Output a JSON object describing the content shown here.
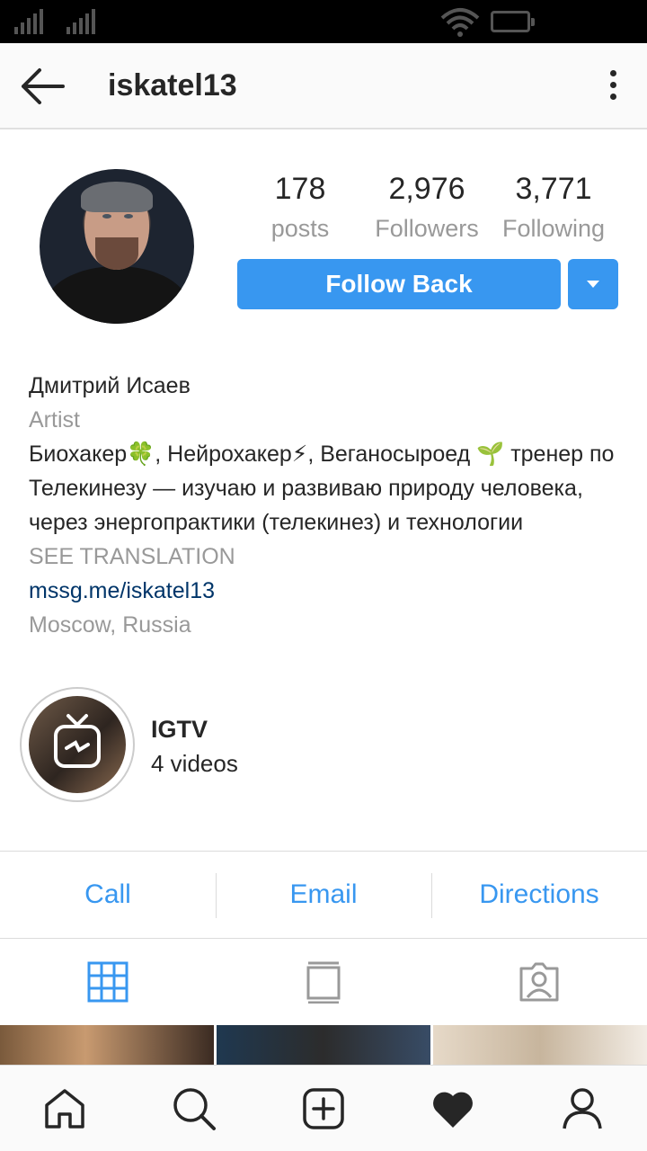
{
  "header": {
    "username": "iskatel13",
    "back_icon": "arrow-left-icon",
    "more_icon": "more-vertical-icon"
  },
  "stats": {
    "posts": {
      "value": "178",
      "label": "posts"
    },
    "followers": {
      "value": "2,976",
      "label": "Followers"
    },
    "following": {
      "value": "3,771",
      "label": "Following"
    }
  },
  "actions": {
    "follow_label": "Follow Back",
    "dropdown_icon": "caret-down-icon"
  },
  "bio": {
    "name": "Дмитрий Исаев",
    "category": "Artist",
    "text": "Биохакер🍀, Нейрохакер⚡, Веганосыроед 🌱 тренер по Телекинезу — изучаю и развиваю природу человека, через энергопрактики (телекинез) и технологии",
    "see_translation": "SEE TRANSLATION",
    "link": "mssg.me/iskatel13",
    "location": "Moscow, Russia"
  },
  "igtv": {
    "title": "IGTV",
    "count": "4 videos"
  },
  "contact": {
    "call": "Call",
    "email": "Email",
    "directions": "Directions"
  },
  "tabs": [
    "grid-icon",
    "feed-list-icon",
    "tagged-person-icon"
  ],
  "bottom_nav": [
    "home-icon",
    "search-icon",
    "add-post-icon",
    "activity-heart-icon",
    "profile-icon"
  ],
  "colors": {
    "accent": "#3897f0",
    "link": "#003569",
    "muted": "#999999",
    "text": "#262626"
  }
}
